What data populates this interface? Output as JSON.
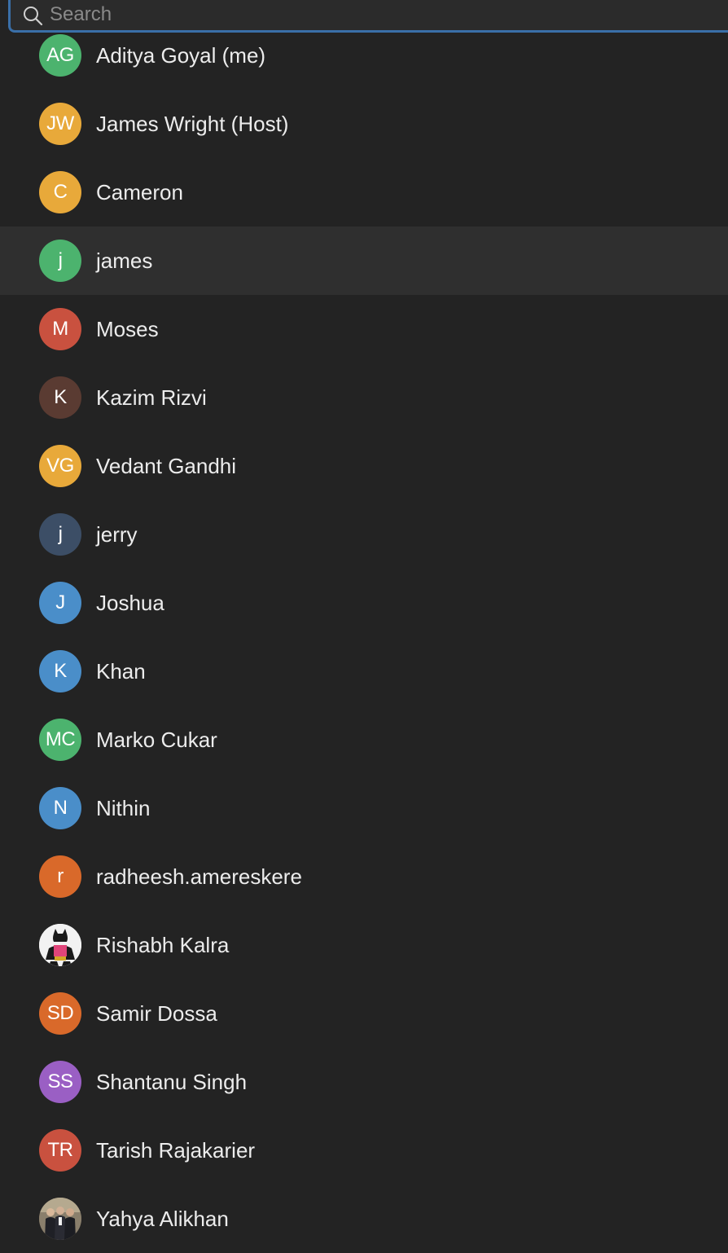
{
  "search": {
    "placeholder": "Search",
    "value": ""
  },
  "participants": [
    {
      "initials": "AG",
      "name": "Aditya Goyal (me)",
      "color": "#4cb36e"
    },
    {
      "initials": "JW",
      "name": "James Wright (Host)",
      "color": "#e8a93a"
    },
    {
      "initials": "C",
      "name": "Cameron",
      "color": "#e8a93a"
    },
    {
      "initials": "j",
      "name": "james",
      "color": "#4cb36e"
    },
    {
      "initials": "M",
      "name": "Moses",
      "color": "#c9513f"
    },
    {
      "initials": "K",
      "name": "Kazim Rizvi",
      "color": "#5a3b32"
    },
    {
      "initials": "VG",
      "name": "Vedant Gandhi",
      "color": "#e8a93a"
    },
    {
      "initials": "j",
      "name": "jerry",
      "color": "#3c4e66"
    },
    {
      "initials": "J",
      "name": "Joshua",
      "color": "#4a8ec9"
    },
    {
      "initials": "K",
      "name": "Khan",
      "color": "#4a8ec9"
    },
    {
      "initials": "MC",
      "name": "Marko Cukar",
      "color": "#4cb36e"
    },
    {
      "initials": "N",
      "name": "Nithin",
      "color": "#4a8ec9"
    },
    {
      "initials": "r",
      "name": "radheesh.amereskere",
      "color": "#d9692a"
    },
    {
      "initials": "",
      "name": "Rishabh Kalra",
      "color": "#f4f4f4",
      "photo": "superhero-photo-icon"
    },
    {
      "initials": "SD",
      "name": "Samir Dossa",
      "color": "#d9692a"
    },
    {
      "initials": "SS",
      "name": "Shantanu Singh",
      "color": "#9a5fc4"
    },
    {
      "initials": "TR",
      "name": "Tarish Rajakarier",
      "color": "#c9513f"
    },
    {
      "initials": "",
      "name": "Yahya Alikhan",
      "color": "#6b6355",
      "photo": "group-photo-icon"
    }
  ],
  "highlighted_index": 3
}
